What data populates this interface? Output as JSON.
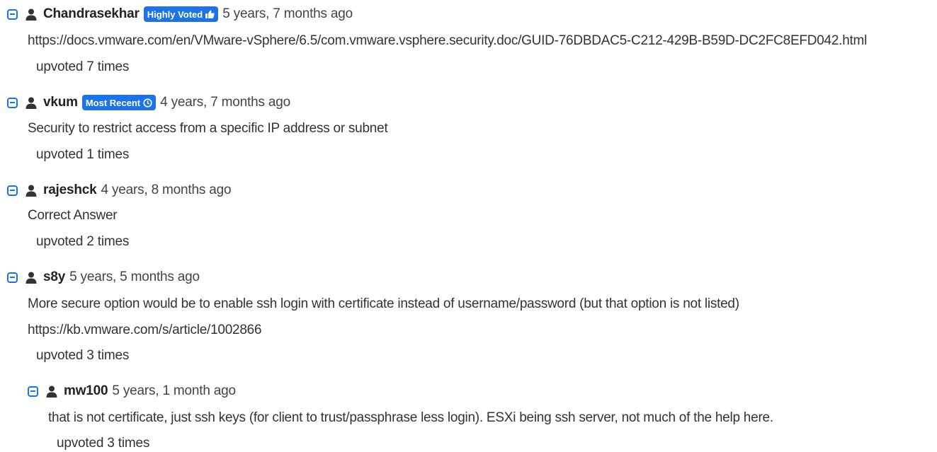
{
  "comments": [
    {
      "username": "Chandrasekhar",
      "badge": "Highly Voted",
      "badge_icon": "thumbs-up-icon",
      "date": "5 years, 7 months ago",
      "lines": [
        "https://docs.vmware.com/en/VMware-vSphere/6.5/com.vmware.vsphere.security.doc/GUID-76DBDAC5-C212-429B-B59D-DC2FC8EFD042.html"
      ],
      "votes": "upvoted 7 times"
    },
    {
      "username": "vkum",
      "badge": "Most Recent",
      "badge_icon": "clock-icon",
      "date": "4 years, 7 months ago",
      "lines": [
        "Security to restrict access from a specific IP address or subnet"
      ],
      "votes": "upvoted 1 times"
    },
    {
      "username": "rajeshck",
      "date": "4 years, 8 months ago",
      "lines": [
        "Correct Answer"
      ],
      "votes": "upvoted 2 times"
    },
    {
      "username": "s8y",
      "date": "5 years, 5 months ago",
      "lines": [
        "More secure option would be to enable ssh login with certificate instead of username/password (but that option is not listed)",
        "https://kb.vmware.com/s/article/1002866"
      ],
      "votes": "upvoted 3 times"
    },
    {
      "username": "mw100",
      "date": "5 years, 1 month ago",
      "lines": [
        "that is not certificate, just ssh keys (for client to trust/passphrase less login). ESXi being ssh server, not much of the help here."
      ],
      "votes": "upvoted 3 times"
    }
  ],
  "colors": {
    "accent": "#1a73e8",
    "text": "#333333"
  }
}
